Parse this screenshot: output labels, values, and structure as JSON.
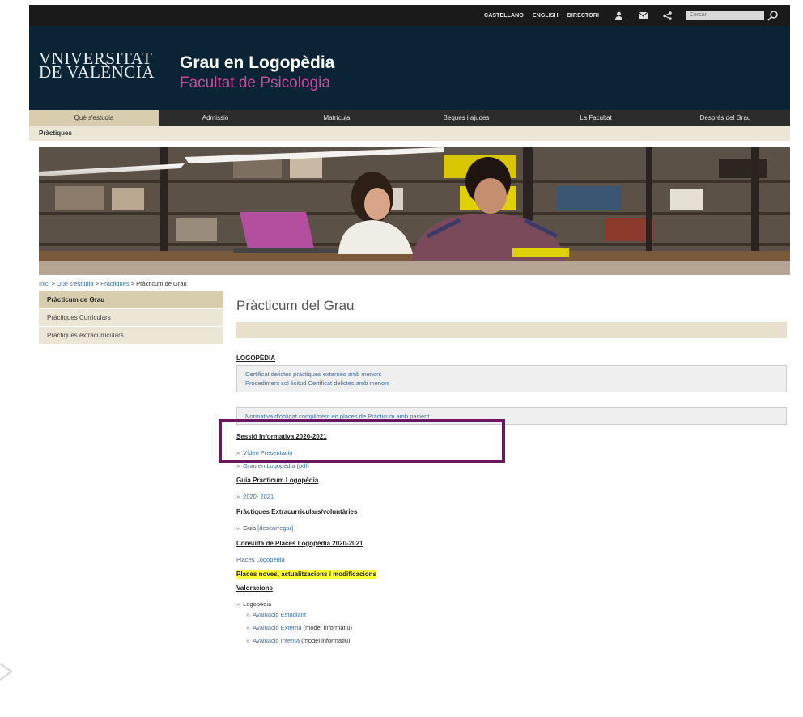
{
  "topbar": {
    "lang_es": "CASTELLANO",
    "lang_en": "ENGLISH",
    "directory": "DIRECTORI",
    "icons": [
      "user-icon",
      "mail-icon",
      "share-icon"
    ],
    "search_placeholder": "Cercar"
  },
  "header": {
    "logo_line1": "VNIVERSITAT",
    "logo_line2": "DE VALÈNCIA",
    "title": "Grau en Logopèdia",
    "subtitle": "Facultat de Psicologia",
    "bg_color": "#0a2435",
    "accent_color": "#c94b9a"
  },
  "mainnav": {
    "items": [
      {
        "label": "Què s'estudia",
        "active": true
      },
      {
        "label": "Admissió",
        "active": false
      },
      {
        "label": "Matrícula",
        "active": false
      },
      {
        "label": "Beques i ajudes",
        "active": false
      },
      {
        "label": "La Facultat",
        "active": false
      },
      {
        "label": "Després del Grau",
        "active": false
      }
    ]
  },
  "subnav": {
    "label": "Pràctiques"
  },
  "breadcrumb": {
    "items": [
      "Inici",
      "Què s'estudia",
      "Pràctiques"
    ],
    "current": "Pràcticum de Grau",
    "separator": ">"
  },
  "sidebar": {
    "items": [
      {
        "label": "Pràcticum de Grau",
        "active": true
      },
      {
        "label": "Pràctiques Curriculars",
        "active": false
      },
      {
        "label": "Pràctiques extracurriculars",
        "active": false
      }
    ]
  },
  "main": {
    "title": "Pràcticum del Grau",
    "logopedia_heading": "LOGOPÈDIA",
    "logopedia_links": [
      "Certificat delictes pràctiques externes amb menors",
      "Procediment sol·licitud Certificat delictes amb menors"
    ],
    "normativa_link": "Normativa d'obligat compliment en places de Pràcticum amb pacient",
    "sessio_heading": "Sessió Informativa 2020-2021",
    "sessio_links": [
      "Vídeo Presentació",
      "Grau en Logopèdia (pdf)"
    ],
    "guia_heading": "Guia Pràcticum Logopèdia",
    "guia_links": [
      "2020- 2021"
    ],
    "extra_heading": "Pràctiques Extracurriculars/voluntàries",
    "extra_item_text": "Guia",
    "extra_item_link": "[descarregar]",
    "consulta_heading": "Consulta de Places Logopèdia 2020-2021",
    "consulta_link": "Places Logopèdia",
    "places_noves": "Places noves, actualitzacions i modificacions",
    "valoracions_heading": "Valoracions",
    "valoracions_parent": "Logopèdia",
    "valoracions_children": [
      {
        "link": "Avaluació Estudiant",
        "note": ""
      },
      {
        "link": "Avaluació Externa",
        "note": " (model informatiu)"
      },
      {
        "link": "Avaluació Interna",
        "note": " (model informatiu)"
      }
    ],
    "bullet_glyph": "»"
  },
  "colors": {
    "nav_active": "#d8ceae",
    "link": "#3b6ea8",
    "highlight_frame": "#6b1660",
    "yellow_highlight": "#ffff33"
  }
}
